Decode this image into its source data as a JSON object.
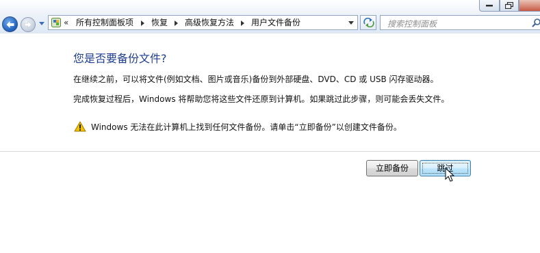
{
  "address_bar": {
    "overflow": "«",
    "crumbs": [
      "所有控制面板项",
      "恢复",
      "高级恢复方法",
      "用户文件备份"
    ]
  },
  "search": {
    "placeholder": "搜索控制面板"
  },
  "content": {
    "title": "您是否要备份文件?",
    "paragraph1": "在继续之前，可以将文件(例如文档、图片或音乐)备份到外部硬盘、DVD、CD 或 USB 闪存驱动器。",
    "paragraph2": "完成恢复过程后，Windows 将帮助您将这些文件还原到计算机。如果跳过此步骤，则可能会丢失文件。",
    "warning": "Windows 无法在此计算机上找到任何文件备份。请单击“立即备份”以创建文件备份。"
  },
  "buttons": {
    "backup_now": "立即备份",
    "skip": "跳过"
  },
  "colors": {
    "title": "#1e3d8f",
    "accent_button": "#bee6fd",
    "warning": "#f2c200"
  },
  "icons": [
    "back-arrow-icon",
    "forward-arrow-icon",
    "control-panel-icon",
    "refresh-icon",
    "search-icon",
    "warning-icon",
    "cursor-icon"
  ]
}
